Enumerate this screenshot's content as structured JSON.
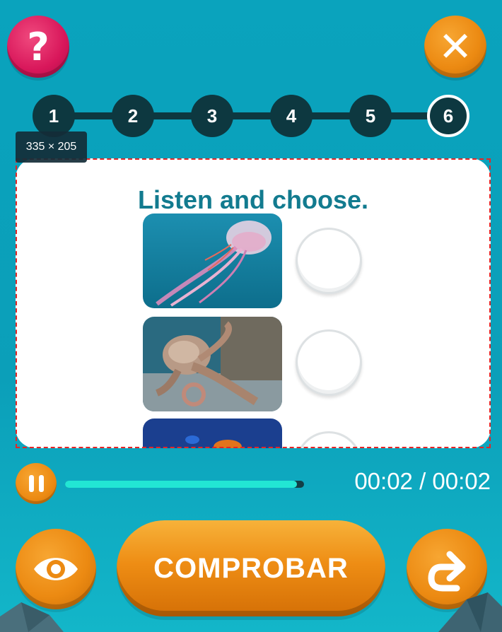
{
  "header": {
    "help_icon": "question-mark-icon",
    "help_label": "?",
    "close_icon": "close-icon",
    "close_label": "✕"
  },
  "steps": [
    {
      "label": "1",
      "current": false
    },
    {
      "label": "2",
      "current": false
    },
    {
      "label": "3",
      "current": false
    },
    {
      "label": "4",
      "current": false
    },
    {
      "label": "5",
      "current": false
    },
    {
      "label": "6",
      "current": true
    }
  ],
  "size_tag": "335 × 205",
  "exercise": {
    "instruction": "Listen and choose.",
    "options": [
      {
        "image": "jellyfish-image",
        "selected": false
      },
      {
        "image": "octopus-image",
        "selected": false
      },
      {
        "image": "fish-image",
        "selected": false
      }
    ]
  },
  "audio": {
    "pause_icon": "pause-icon",
    "progress": 0.97,
    "time": "00:02 / 00:02"
  },
  "footer": {
    "eye_icon": "eye-icon",
    "check_label": "COMPROBAR",
    "next_icon": "redo-arrow-icon"
  },
  "colors": {
    "background": "#0aa3bd",
    "accent_orange": "#ec8a12",
    "help_pink": "#d8165a",
    "step_dark": "#0d3840",
    "instruction_teal": "#127b8f",
    "progress_fill": "#22e6d4"
  }
}
